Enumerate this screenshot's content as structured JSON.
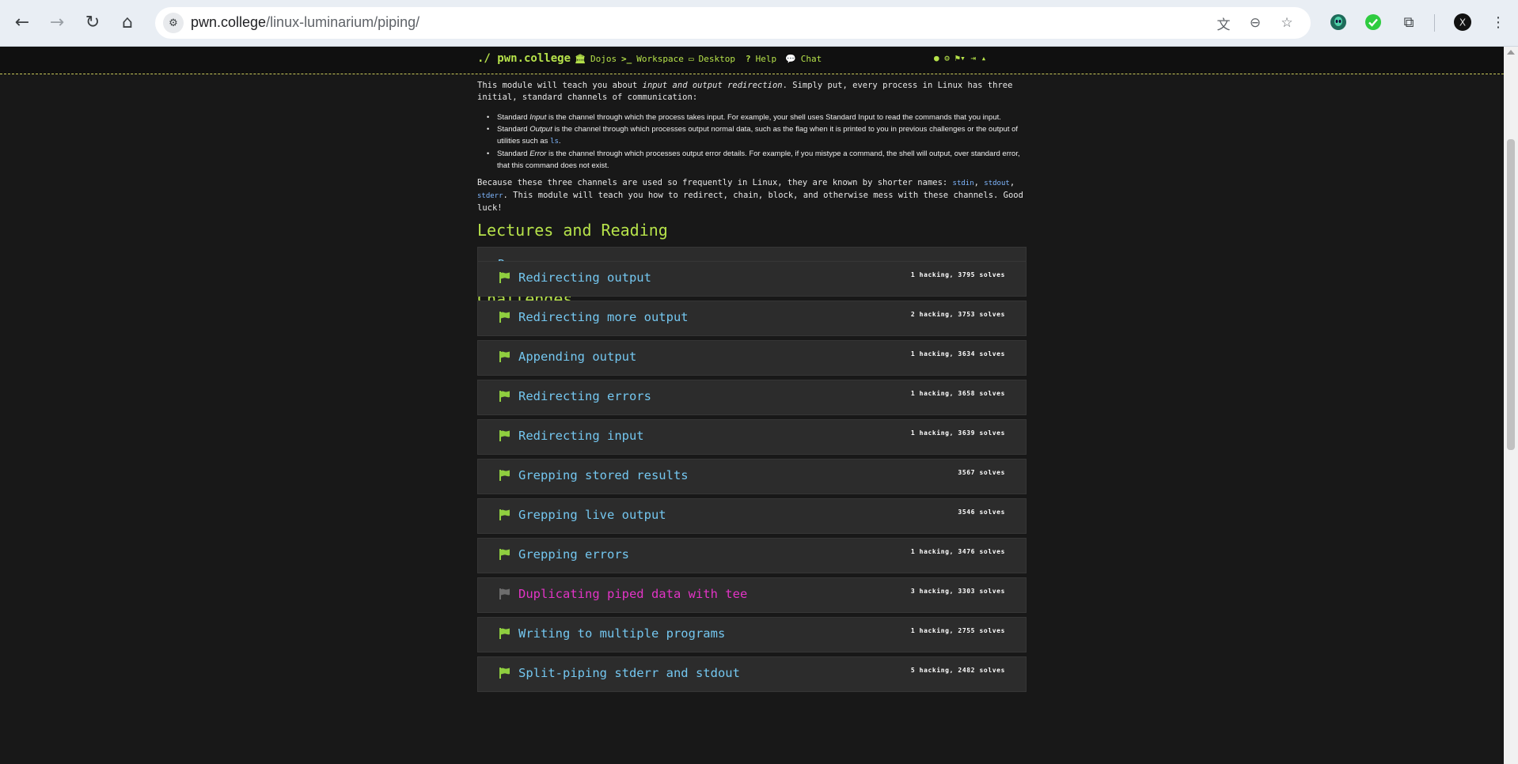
{
  "browser": {
    "url_domain": "pwn.college",
    "url_path": "/linux-luminarium/piping/",
    "icons": [
      "back-icon",
      "forward-icon",
      "reload-icon",
      "home-icon",
      "site-settings-icon",
      "translate-icon",
      "zoom-icon",
      "bookmark-star-icon",
      "extension-alien-icon",
      "extension-check-icon",
      "extensions-puzzle-icon",
      "profile-avatar",
      "menu-kebab-icon"
    ],
    "glyphs": {
      "back": "←",
      "forward": "→",
      "reload": "↻",
      "home": "⌂",
      "tune": "⚙",
      "translate": "文",
      "zoom": "⊖",
      "star": "☆",
      "puzzle": "⧉",
      "menu": "⋮",
      "profile": "X",
      "check": "✓",
      "alien": "☺"
    }
  },
  "nav": {
    "brand": "./ pwn.college",
    "dojos_icon": "🏛",
    "dojos": "Dojos",
    "workspace_icon": ">_",
    "workspace": "Workspace",
    "desktop_icon": "▭",
    "desktop": "Desktop",
    "help_icon": "?",
    "help": "Help",
    "chat_icon": "💬",
    "chat": "Chat",
    "right_icons": "● ⚙ ⚑▾ ⇥ ▴"
  },
  "intro": {
    "p1_a": "This module will teach you about ",
    "p1_em": "input and output redirection",
    "p1_b": ". Simply put, every process in Linux has three initial, standard channels of communication:",
    "bullets": [
      {
        "pre": "Standard ",
        "em": "Input",
        "post": " is the channel through which the process takes input. For example, your shell uses Standard Input to read the commands that you input.",
        "code": "",
        "tail": ""
      },
      {
        "pre": "Standard ",
        "em": "Output",
        "post": " is the channel through which processes output normal data, such as the flag when it is printed to you in previous challenges or the output of utilities such as ",
        "code": "ls",
        "tail": "."
      },
      {
        "pre": "Standard ",
        "em": "Error",
        "post": " is the channel through which processes output error details. For example, if you mistype a command, the shell will output, over standard error, that this command does not exist.",
        "code": "",
        "tail": ""
      }
    ],
    "p2_a": "Because these three channels are used so frequently in Linux, they are known by shorter names: ",
    "p2_c1": "stdin",
    "p2_s1": ", ",
    "p2_c2": "stdout",
    "p2_s2": ", ",
    "p2_c3": "stderr",
    "p2_b": ". This module will teach you how to redirect, chain, block, and otherwise mess with these channels. Good luck!"
  },
  "lectures": {
    "heading": "Lectures and Reading",
    "items": [
      "Resources"
    ]
  },
  "challenges": {
    "heading": "Challenges",
    "items": [
      {
        "title": "Redirecting output",
        "stats": "1 hacking, 3795 solves",
        "solved": true
      },
      {
        "title": "Redirecting more output",
        "stats": "2 hacking, 3753 solves",
        "solved": true
      },
      {
        "title": "Appending output",
        "stats": "1 hacking, 3634 solves",
        "solved": true
      },
      {
        "title": "Redirecting errors",
        "stats": "1 hacking, 3658 solves",
        "solved": true
      },
      {
        "title": "Redirecting input",
        "stats": "1 hacking, 3639 solves",
        "solved": true
      },
      {
        "title": "Grepping stored results",
        "stats": "3567 solves",
        "solved": true
      },
      {
        "title": "Grepping live output",
        "stats": "3546 solves",
        "solved": true
      },
      {
        "title": "Grepping errors",
        "stats": "1 hacking, 3476 solves",
        "solved": true
      },
      {
        "title": "Duplicating piped data with tee",
        "stats": "3 hacking, 3303 solves",
        "solved": false
      },
      {
        "title": "Writing to multiple programs",
        "stats": "1 hacking, 2755 solves",
        "solved": true
      },
      {
        "title": "Split-piping stderr and stdout",
        "stats": "5 hacking, 2482 solves",
        "solved": true
      }
    ]
  },
  "colors": {
    "accent_green": "#b6e24a",
    "link_blue": "#74c7f0",
    "active_magenta": "#e234c6",
    "flag_solved": "#8fce3f",
    "flag_unsolved": "#6c6c6c",
    "card_bg": "#2c2c2c",
    "page_bg": "#181818"
  }
}
